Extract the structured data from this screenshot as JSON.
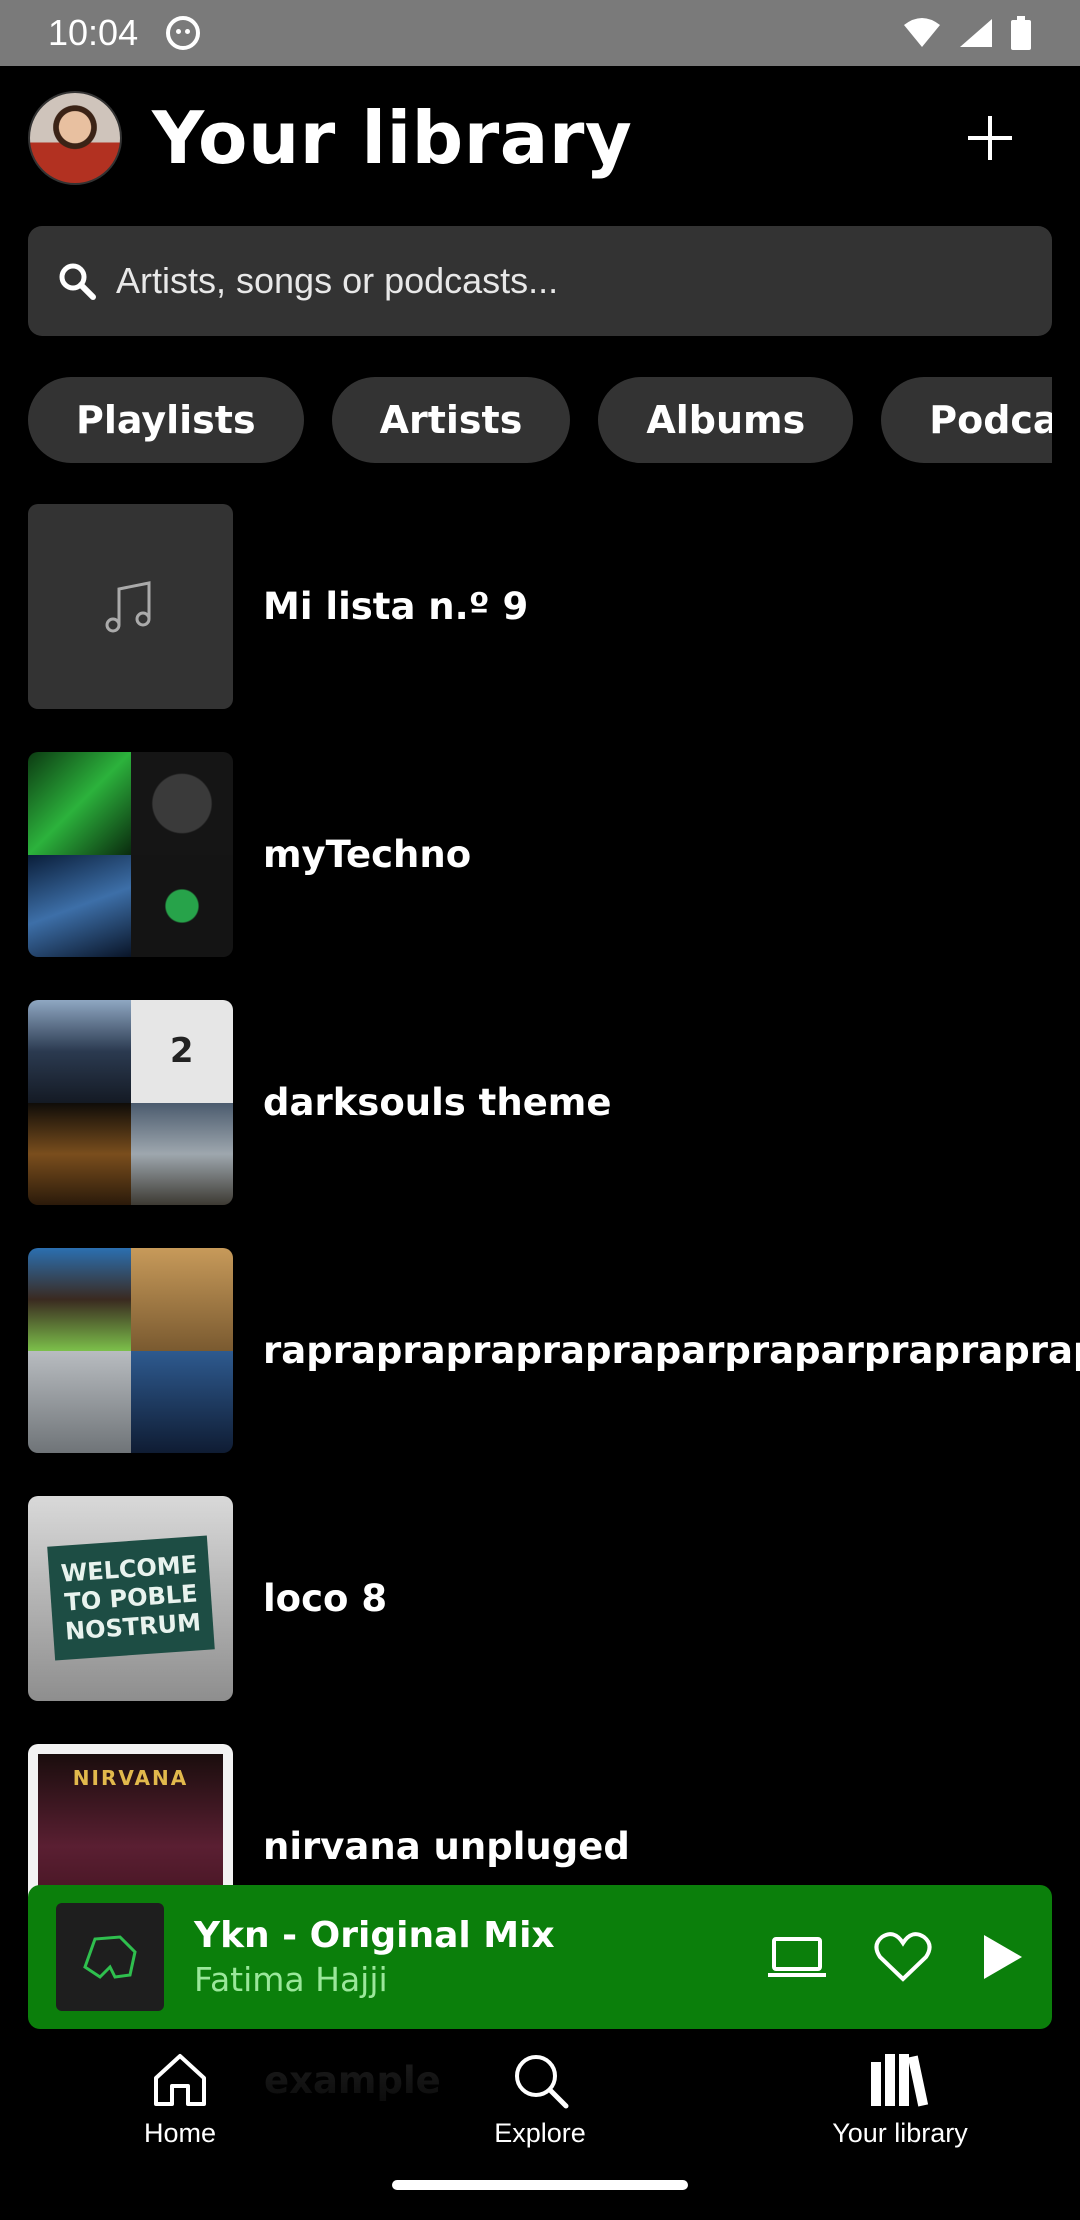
{
  "status_bar": {
    "time": "10:04"
  },
  "header": {
    "title": "Your library"
  },
  "search": {
    "placeholder": "Artists, songs or podcasts..."
  },
  "filters": [
    {
      "label": "Playlists"
    },
    {
      "label": "Artists"
    },
    {
      "label": "Albums"
    },
    {
      "label": "Podcasts"
    }
  ],
  "library": {
    "items": [
      {
        "title": "Mi lista n.º 9"
      },
      {
        "title": "myTechno"
      },
      {
        "title": "darksouls theme"
      },
      {
        "title": "rapraprapraprapraparpraparprapraprapraprap"
      },
      {
        "title": "loco 8",
        "cover_text": "WELCOME TO POBLE NOSTRUM"
      },
      {
        "title": "nirvana unpluged",
        "cover_text": "NIRVANA"
      },
      {
        "title": "example"
      }
    ]
  },
  "player": {
    "track": "Ykn - Original Mix",
    "artist": "Fatima Hajji",
    "background_color": "#0b7f0b"
  },
  "nav": {
    "items": [
      {
        "label": "Home",
        "icon": "home-icon"
      },
      {
        "label": "Explore",
        "icon": "search-icon"
      },
      {
        "label": "Your library",
        "icon": "library-icon"
      }
    ]
  }
}
